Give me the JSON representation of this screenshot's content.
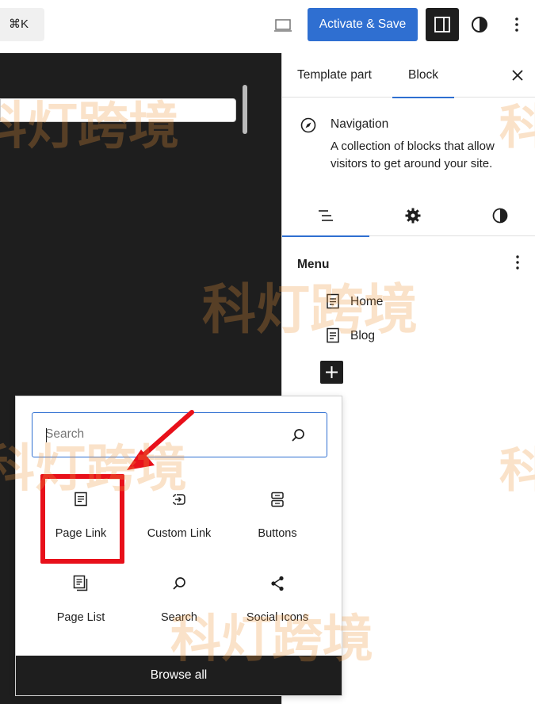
{
  "toolbar": {
    "command_shortcut": "⌘K",
    "activate_save_label": "Activate & Save",
    "device_preview_icon": "laptop-icon",
    "settings_toggle_icon": "sidebar-panel-icon",
    "styles_icon": "half-circle-icon",
    "more_icon": "vertical-ellipsis-icon"
  },
  "sidebar": {
    "tabs": [
      {
        "label": "Template part"
      },
      {
        "label": "Block"
      }
    ],
    "block_card": {
      "icon": "compass-icon",
      "title": "Navigation",
      "description": "A collection of blocks that allow visitors to get around your site."
    },
    "subtabs": [
      {
        "icon": "list-view-icon"
      },
      {
        "icon": "gear-icon"
      },
      {
        "icon": "half-circle-icon"
      }
    ],
    "menu": {
      "label": "Menu",
      "items": [
        {
          "label": "Home",
          "icon": "page-icon"
        },
        {
          "label": "Blog",
          "icon": "page-icon"
        }
      ],
      "add_icon": "plus-icon"
    }
  },
  "inserter": {
    "search_placeholder": "Search",
    "blocks": [
      {
        "label": "Page Link",
        "icon": "page-icon"
      },
      {
        "label": "Custom Link",
        "icon": "custom-link-icon"
      },
      {
        "label": "Buttons",
        "icon": "buttons-icon"
      },
      {
        "label": "Page List",
        "icon": "page-list-icon"
      },
      {
        "label": "Search",
        "icon": "search-icon"
      },
      {
        "label": "Social Icons",
        "icon": "share-icon"
      }
    ],
    "browse_all_label": "Browse all"
  },
  "watermark": {
    "text": "科灯跨境"
  },
  "colors": {
    "accent": "#2f6fd1",
    "dark": "#1e1e1e",
    "annotation": "#e8101a",
    "watermark": "#ed963c"
  }
}
